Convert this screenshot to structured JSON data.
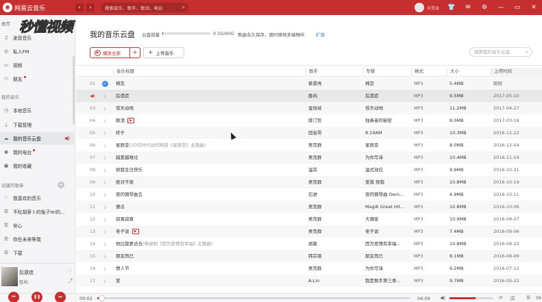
{
  "app": {
    "name": "网易云音乐",
    "logo_icon": "netease-logo-icon",
    "accent": "#c62f2f"
  },
  "titlebar": {
    "search_placeholder": "搜索音乐，歌手，歌词，电台",
    "user_name": "未登录",
    "icons": [
      "back-icon",
      "forward-icon",
      "search-icon",
      "avatar-icon",
      "skin-icon",
      "mail-icon",
      "settings-icon",
      "minimize-icon",
      "maximize-icon",
      "close-icon"
    ]
  },
  "watermark": "秒懂视频",
  "sidebar": {
    "recommend_title": "推荐",
    "recommend": [
      {
        "label": "发现音乐",
        "icon": "music-note-icon"
      },
      {
        "label": "私人FM",
        "icon": "radio-icon"
      },
      {
        "label": "视频",
        "icon": "video-icon"
      },
      {
        "label": "朋友",
        "icon": "friends-icon",
        "dot": true
      }
    ],
    "my_music_title": "我的音乐",
    "my_music": [
      {
        "label": "本地音乐",
        "icon": "local-music-icon"
      },
      {
        "label": "下载管理",
        "icon": "download-icon"
      },
      {
        "label": "我的音乐云盘",
        "icon": "cloud-icon",
        "active": true
      },
      {
        "label": "我的电台",
        "icon": "my-radio-icon",
        "dot": true
      },
      {
        "label": "我的收藏",
        "icon": "collection-icon"
      }
    ],
    "created_title": "创建的歌单",
    "created": [
      {
        "label": "我喜欢的音乐",
        "icon": "heart-icon"
      },
      {
        "label": "不吃胡萝卜的兔子lei的...",
        "icon": "playlist-icon"
      },
      {
        "label": "安心",
        "icon": "playlist-icon"
      },
      {
        "label": "你在未来等我",
        "icon": "playlist-icon"
      },
      {
        "label": "下载",
        "icon": "playlist-icon"
      }
    ]
  },
  "mini_player": {
    "title": "后遗症",
    "artist": "胜屿"
  },
  "cloud": {
    "title": "我的音乐云盘",
    "capacity_label": "云盘容量",
    "capacity_value": "0.5G/60G",
    "capacity_fraction": 0.008,
    "note": "歌曲永久保存，随时随地多端畅听",
    "expand_link": "扩容",
    "play_all_label": "播放全部",
    "upload_label": "上传音乐",
    "search_placeholder": "搜索我的音乐云盘"
  },
  "table": {
    "columns": [
      "音乐标题",
      "歌手",
      "专辑",
      "格式",
      "大小",
      "上传时间"
    ],
    "rows": [
      {
        "num": "01",
        "title": "棉恋",
        "artist": "蔡景亮",
        "album": "棉恋",
        "format": "MP3",
        "size": "5.4MB",
        "date": "刚刚",
        "status": "uploaded"
      },
      {
        "num": "",
        "title": "后遗症",
        "artist": "胜屿",
        "album": "后遗症",
        "format": "MP3",
        "size": "9.5MB",
        "date": "2017-05-10",
        "status": "playing"
      },
      {
        "num": "03",
        "title": "惊天动地",
        "artist": "金玟岐",
        "album": "惊天动地",
        "format": "MP3",
        "size": "11.2MB",
        "date": "2017-04-27"
      },
      {
        "num": "04",
        "title": "眼泪",
        "artist": "薛汀哲",
        "album": "独奏者的秘密",
        "format": "MP3",
        "size": "8.0MB",
        "date": "2017-03-16",
        "mv": true
      },
      {
        "num": "05",
        "title": "终于",
        "artist": "回音哥",
        "album": "8:19AM",
        "format": "MP3",
        "size": "10.3MB",
        "date": "2016-12-22"
      },
      {
        "num": "06",
        "title": "星辰变",
        "subtitle": "(2D次时代动作网游《星辰变》主题曲)",
        "artist": "吴克群",
        "album": "星辰变",
        "format": "MP3",
        "size": "8.0MB",
        "date": "2016-12-04"
      },
      {
        "num": "07",
        "title": "越爱越难过",
        "artist": "吴克群",
        "album": "为你写诗",
        "format": "MP3",
        "size": "10.4MB",
        "date": "2016-11-19"
      },
      {
        "num": "08",
        "title": "祝我生日快乐",
        "artist": "温岚",
        "album": "温式效应",
        "format": "MP3",
        "size": "9.9MB",
        "date": "2016-10-21"
      },
      {
        "num": "09",
        "title": "绝对不放",
        "artist": "吴克群",
        "album": "爱我 恨我",
        "format": "MP3",
        "size": "10.8MB",
        "date": "2016-10-19"
      },
      {
        "num": "10",
        "title": "夜的钢琴曲五",
        "artist": "石进",
        "album": "夜的钢琴曲 Dem...",
        "format": "MP3",
        "size": "4.9MB",
        "date": "2016-10-11"
      },
      {
        "num": "11",
        "title": "傻瓜",
        "artist": "吴克群",
        "album": "MagiK Great Hit...",
        "format": "MP3",
        "size": "10.8MB",
        "date": "2016-10-06"
      },
      {
        "num": "12",
        "title": "寂寞寂寞",
        "artist": "吴克群",
        "album": "大頭家",
        "format": "MP3",
        "size": "10.9MB",
        "date": "2016-09-07"
      },
      {
        "num": "13",
        "title": "老子说",
        "artist": "吴克群",
        "album": "老子说",
        "format": "MP3",
        "size": "7.4MB",
        "date": "2016-09-06",
        "mv": true
      },
      {
        "num": "14",
        "title": "他比我更适合",
        "subtitle": "(电视剧《因为爱情有幸福》主题曲)",
        "artist": "胡夏",
        "album": "因为爱情有幸福...",
        "format": "MP3",
        "size": "10.8MB",
        "date": "2016-08-22"
      },
      {
        "num": "15",
        "title": "朋友而已",
        "artist": "韩宗祖",
        "album": "朋友而已",
        "format": "MP3",
        "size": "8.1MB",
        "date": "2016-08-09"
      },
      {
        "num": "16",
        "title": "情人节",
        "artist": "吴克群",
        "album": "为你写诗",
        "format": "MP3",
        "size": "9.2MB",
        "date": "2016-07-12"
      },
      {
        "num": "17",
        "title": "爱",
        "artist": "A-Lin",
        "album": "我是歌手第三季...",
        "format": "MP3",
        "size": "9.7MB",
        "date": "2016-05-22"
      }
    ]
  },
  "player": {
    "elapsed": "00:02",
    "duration": "04:09",
    "progress_fraction": 0.008,
    "volume_fraction": 0.6,
    "playlist_count": "59"
  }
}
